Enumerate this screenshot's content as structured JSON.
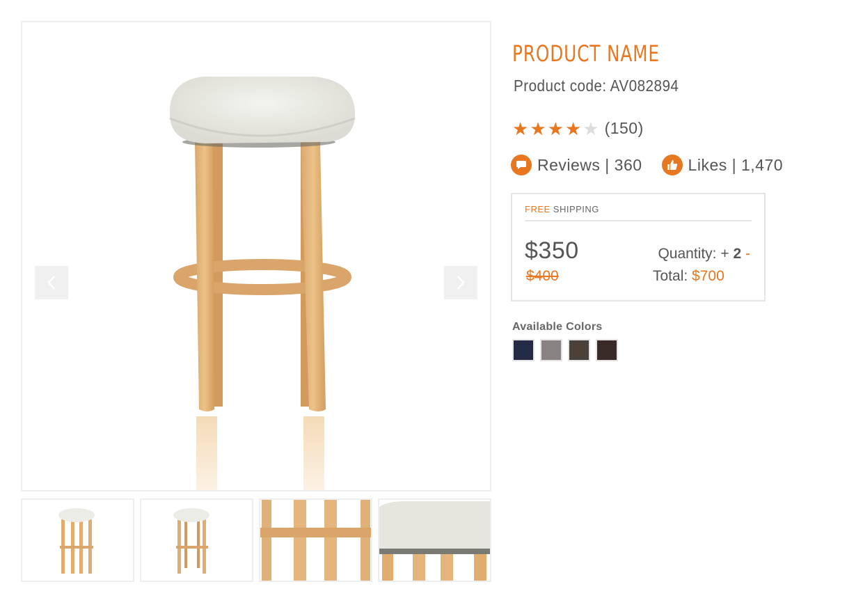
{
  "gallery": {
    "prev_icon": "chevron-left-icon",
    "next_icon": "chevron-right-icon",
    "thumbnails": [
      {
        "label": "full stool view"
      },
      {
        "label": "front stool view"
      },
      {
        "label": "leg detail"
      },
      {
        "label": "seat detail"
      }
    ]
  },
  "product": {
    "name": "PRODUCT NAME",
    "code": "Product code: AV082894",
    "rating": 4,
    "rating_max": 5,
    "rating_count": "(150)",
    "reviews": "Reviews | 360",
    "likes": "Likes | 1,470",
    "reviews_icon": "speech-bubble-icon",
    "likes_icon": "thumbs-up-icon"
  },
  "pricing": {
    "free_label": "FREE",
    "shipping_label": "SHIPPING",
    "price": "$350",
    "old_price": "$400",
    "quantity_label": "Quantity:",
    "plus": "+",
    "quantity": "2",
    "minus": "-",
    "total_label": "Total:",
    "total": "$700"
  },
  "colors": {
    "label": "Available Colors",
    "swatches": [
      "#252a45",
      "#888282",
      "#4a423a",
      "#3a2a28"
    ]
  },
  "theme": {
    "accent": "#e87722"
  }
}
